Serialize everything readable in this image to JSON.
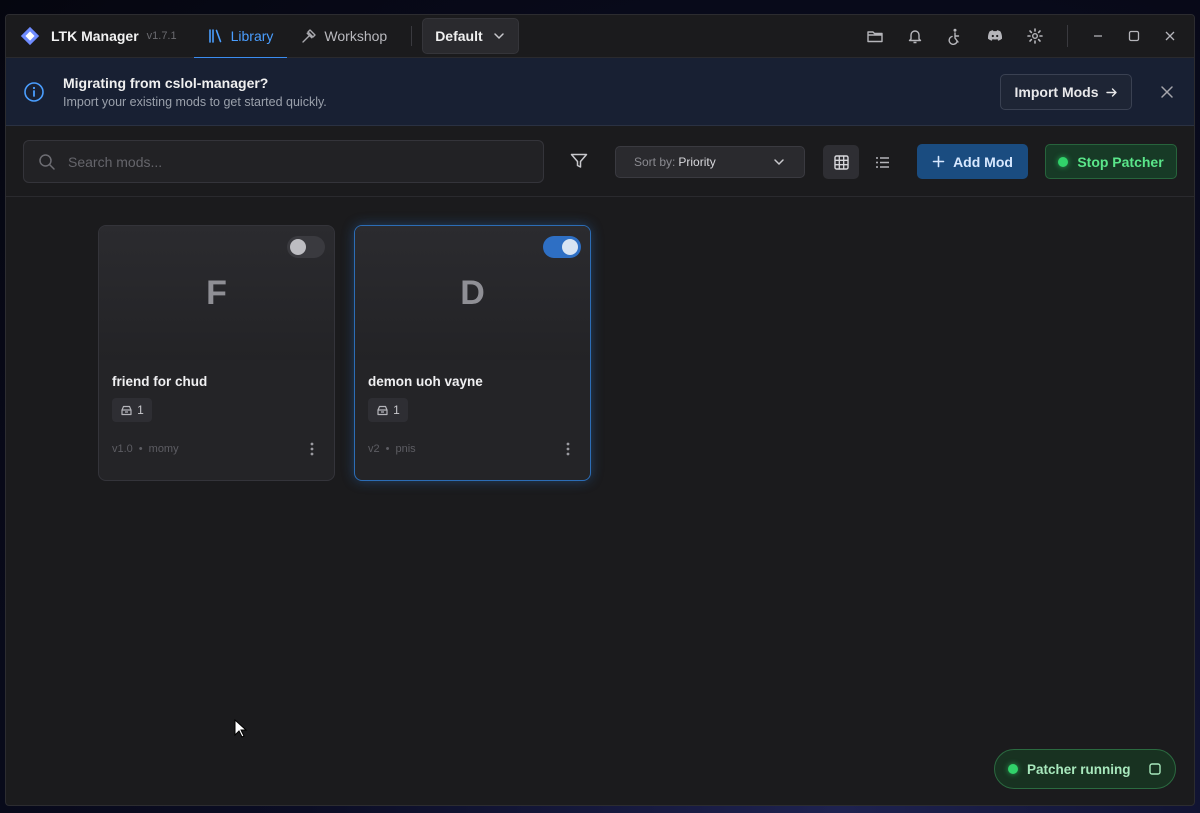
{
  "app": {
    "name": "LTK Manager",
    "version": "v1.7.1"
  },
  "nav": {
    "tabs": [
      {
        "label": "Library",
        "active": true,
        "icon": "library-icon"
      },
      {
        "label": "Workshop",
        "active": false,
        "icon": "hammer-icon"
      }
    ],
    "profile": "Default"
  },
  "titlebar_icons": [
    "folder-icon",
    "bell-icon",
    "accessibility-icon",
    "discord-icon",
    "gear-icon"
  ],
  "banner": {
    "title": "Migrating from cslol-manager?",
    "subtitle": "Import your existing mods to get started quickly.",
    "button_label": "Import Mods"
  },
  "toolbar": {
    "search_placeholder": "Search mods...",
    "sort_prefix": "Sort by:",
    "sort_value": "Priority",
    "add_label": "Add Mod",
    "stop_label": "Stop Patcher"
  },
  "mods": [
    {
      "letter": "F",
      "name": "friend for chud",
      "count": "1",
      "version": "v1.0",
      "author": "momy",
      "enabled": false
    },
    {
      "letter": "D",
      "name": "demon uoh vayne",
      "count": "1",
      "version": "v2",
      "author": "pnis",
      "enabled": true
    }
  ],
  "status": {
    "label": "Patcher running"
  },
  "colors": {
    "accent": "#3b8df0",
    "running_green": "#31d26a"
  }
}
